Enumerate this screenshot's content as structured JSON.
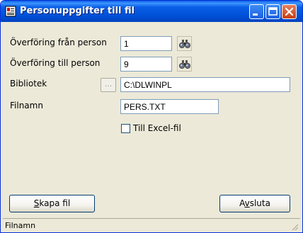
{
  "window": {
    "title": "Personuppgifter till fil"
  },
  "form": {
    "from_label": "Överföring från person",
    "from_value": "1",
    "to_label": "Överföring till person",
    "to_value": "9",
    "library_label": "Bibliotek",
    "library_browse": "...",
    "library_value": "C:\\DLWINPL",
    "filename_label": "Filnamn",
    "filename_value": "PERS.TXT",
    "excel_label": "Till Excel-fil",
    "excel_checked": false
  },
  "buttons": {
    "create_pre": "",
    "create_u": "S",
    "create_post": "kapa fil",
    "exit_pre": "A",
    "exit_u": "v",
    "exit_post": "sluta"
  },
  "statusbar": {
    "text": "Filnamn"
  },
  "icons": {
    "title": "app-icon",
    "find": "binoculars-icon",
    "minimize": "minimize-icon",
    "maximize": "maximize-icon",
    "close": "close-icon"
  },
  "colors": {
    "titlebar": "#0a5fe6",
    "close_button": "#c83d11",
    "face": "#ece9d8"
  }
}
